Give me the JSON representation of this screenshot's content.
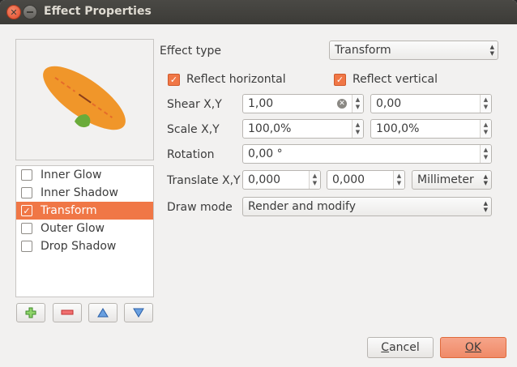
{
  "window": {
    "title": "Effect Properties"
  },
  "preview_colors": {
    "ellipse": "#f0962a",
    "leaf": "#6aab3a",
    "accent": "#f07746"
  },
  "effects_list": {
    "items": [
      {
        "label": "Inner Glow",
        "checked": false,
        "selected": false
      },
      {
        "label": "Inner Shadow",
        "checked": false,
        "selected": false
      },
      {
        "label": "Transform",
        "checked": true,
        "selected": true
      },
      {
        "label": "Outer Glow",
        "checked": false,
        "selected": false
      },
      {
        "label": "Drop Shadow",
        "checked": false,
        "selected": false
      }
    ]
  },
  "list_buttons": {
    "add_icon": "plus-icon",
    "remove_icon": "minus-icon",
    "up_icon": "arrow-up-icon",
    "down_icon": "arrow-down-icon"
  },
  "form": {
    "effect_type_label": "Effect type",
    "effect_type_value": "Transform",
    "reflect_horizontal_label": "Reflect horizontal",
    "reflect_vertical_label": "Reflect vertical",
    "shear_label": "Shear X,Y",
    "shear_x": "1,00",
    "shear_y": "0,00",
    "scale_label": "Scale X,Y",
    "scale_x": "100,0%",
    "scale_y": "100,0%",
    "rotation_label": "Rotation",
    "rotation_value": "0,00 °",
    "translate_label": "Translate X,Y",
    "translate_x": "0,000",
    "translate_y": "0,000",
    "translate_unit": "Millimeter",
    "draw_mode_label": "Draw mode",
    "draw_mode_value": "Render and modify"
  },
  "footer": {
    "cancel_prefix": "",
    "cancel_mnemonic": "C",
    "cancel_rest": "ancel",
    "ok_mnemonic": "O",
    "ok_rest": "K"
  }
}
